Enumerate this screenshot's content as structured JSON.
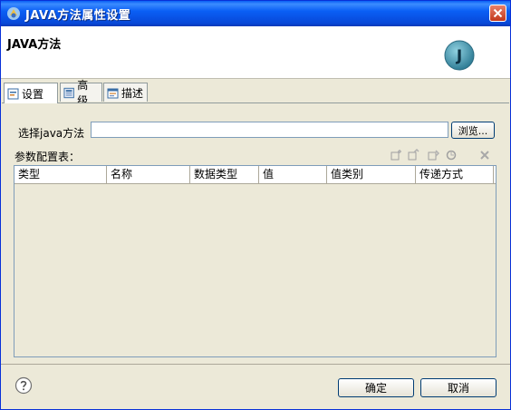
{
  "window": {
    "title": "JAVA方法属性设置"
  },
  "header": {
    "title": "JAVA方法",
    "logo_letter": "J"
  },
  "tabs": [
    {
      "label": "设置",
      "active": true
    },
    {
      "label": "高级",
      "active": false
    },
    {
      "label": "描述",
      "active": false
    }
  ],
  "form": {
    "java_method_label": "选择java方法",
    "java_method_value": "",
    "browse_label": "浏览..."
  },
  "params": {
    "label": "参数配置表：",
    "columns": [
      "类型",
      "名称",
      "数据类型",
      "值",
      "值类别",
      "传递方式"
    ],
    "rows": []
  },
  "footer": {
    "ok_label": "确定",
    "cancel_label": "取消"
  },
  "colors": {
    "titlebar": "#0a5ff5",
    "close": "#c2381a",
    "logo": "#3a8fa8"
  }
}
